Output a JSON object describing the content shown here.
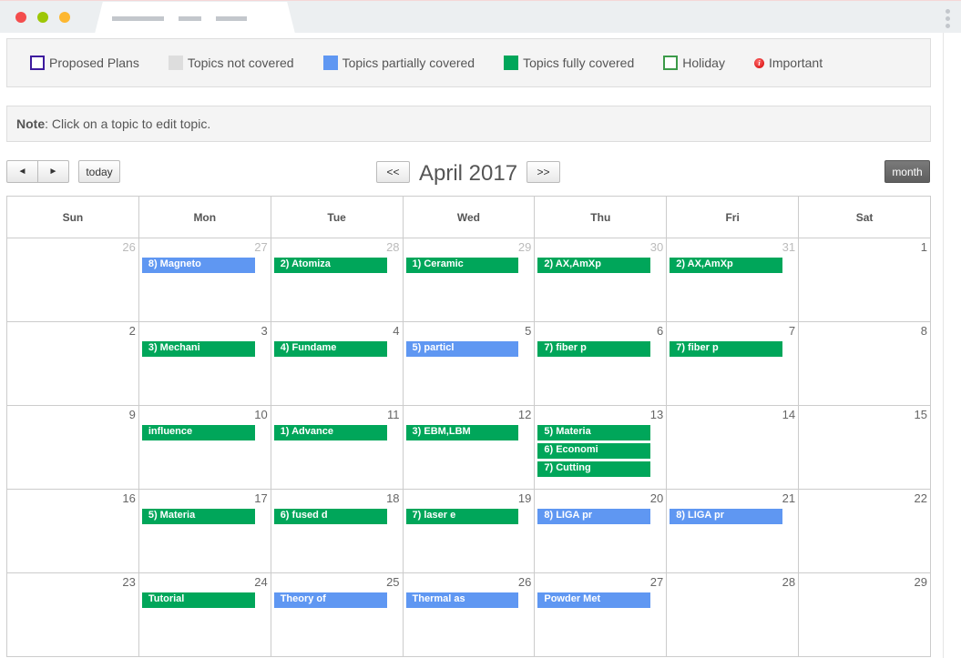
{
  "browser": {
    "window_controls": [
      "close",
      "minimize",
      "maximize"
    ],
    "colors": {
      "close": "#f44d4d",
      "minimize": "#9dc707",
      "maximize": "#fdb730"
    }
  },
  "legend": [
    {
      "label": "Proposed Plans",
      "type": "proposed"
    },
    {
      "label": "Topics not covered",
      "type": "notcov"
    },
    {
      "label": "Topics partially covered",
      "type": "partial"
    },
    {
      "label": "Topics fully covered",
      "type": "full"
    },
    {
      "label": "Holiday",
      "type": "holiday"
    },
    {
      "label": "Important",
      "type": "important"
    }
  ],
  "legend_colors": {
    "proposed": "#3d1a9e",
    "notcov": "#dddddd",
    "partial": "#5f97f2",
    "full": "#00a65a",
    "holiday": "#3c9a49",
    "important": "#d10000"
  },
  "note": {
    "bold": "Note",
    "text": ": Click on a topic to edit topic."
  },
  "toolbar": {
    "prev_icon": "◄",
    "next_icon": "►",
    "today_label": "today",
    "prev_year_label": "<<",
    "next_year_label": ">>",
    "title": "April 2017",
    "month_label": "month"
  },
  "calendar": {
    "weekdays": [
      "Sun",
      "Mon",
      "Tue",
      "Wed",
      "Thu",
      "Fri",
      "Sat"
    ],
    "weeks": [
      [
        {
          "day": "26",
          "other": true,
          "events": []
        },
        {
          "day": "27",
          "other": true,
          "events": [
            {
              "title": "8) Magneto",
              "status": "partial"
            }
          ]
        },
        {
          "day": "28",
          "other": true,
          "events": [
            {
              "title": "2) Atomiza",
              "status": "full"
            }
          ]
        },
        {
          "day": "29",
          "other": true,
          "events": [
            {
              "title": "1) Ceramic",
              "status": "full"
            }
          ]
        },
        {
          "day": "30",
          "other": true,
          "events": [
            {
              "title": "2) AX,AmXp",
              "status": "full"
            }
          ]
        },
        {
          "day": "31",
          "other": true,
          "events": [
            {
              "title": "2) AX,AmXp",
              "status": "full"
            }
          ]
        },
        {
          "day": "1",
          "other": false,
          "events": []
        }
      ],
      [
        {
          "day": "2",
          "other": false,
          "events": []
        },
        {
          "day": "3",
          "other": false,
          "events": [
            {
              "title": "3) Mechani",
              "status": "full"
            }
          ]
        },
        {
          "day": "4",
          "other": false,
          "events": [
            {
              "title": "4) Fundame",
              "status": "full"
            }
          ]
        },
        {
          "day": "5",
          "other": false,
          "events": [
            {
              "title": "5) particl",
              "status": "partial"
            }
          ]
        },
        {
          "day": "6",
          "other": false,
          "events": [
            {
              "title": "7) fiber p",
              "status": "full"
            }
          ]
        },
        {
          "day": "7",
          "other": false,
          "events": [
            {
              "title": "7) fiber p",
              "status": "full"
            }
          ]
        },
        {
          "day": "8",
          "other": false,
          "events": []
        }
      ],
      [
        {
          "day": "9",
          "other": false,
          "events": []
        },
        {
          "day": "10",
          "other": false,
          "events": [
            {
              "title": "influence",
              "status": "full"
            }
          ]
        },
        {
          "day": "11",
          "other": false,
          "events": [
            {
              "title": "1) Advance",
              "status": "full"
            }
          ]
        },
        {
          "day": "12",
          "other": false,
          "events": [
            {
              "title": "3) EBM,LBM",
              "status": "full"
            }
          ]
        },
        {
          "day": "13",
          "other": false,
          "events": [
            {
              "title": "5) Materia",
              "status": "full"
            },
            {
              "title": "6) Economi",
              "status": "full"
            },
            {
              "title": "7) Cutting",
              "status": "full"
            }
          ]
        },
        {
          "day": "14",
          "other": false,
          "events": []
        },
        {
          "day": "15",
          "other": false,
          "events": []
        }
      ],
      [
        {
          "day": "16",
          "other": false,
          "events": []
        },
        {
          "day": "17",
          "other": false,
          "events": [
            {
              "title": "5) Materia",
              "status": "full"
            }
          ]
        },
        {
          "day": "18",
          "other": false,
          "events": [
            {
              "title": "6) fused d",
              "status": "full"
            }
          ]
        },
        {
          "day": "19",
          "other": false,
          "events": [
            {
              "title": "7) laser e",
              "status": "full"
            }
          ]
        },
        {
          "day": "20",
          "other": false,
          "events": [
            {
              "title": "8) LIGA pr",
              "status": "partial"
            }
          ]
        },
        {
          "day": "21",
          "other": false,
          "events": [
            {
              "title": "8) LIGA pr",
              "status": "partial"
            }
          ]
        },
        {
          "day": "22",
          "other": false,
          "events": []
        }
      ],
      [
        {
          "day": "23",
          "other": false,
          "events": []
        },
        {
          "day": "24",
          "other": false,
          "events": [
            {
              "title": "Tutorial",
              "status": "full"
            }
          ]
        },
        {
          "day": "25",
          "other": false,
          "events": [
            {
              "title": "Theory of",
              "status": "partial"
            }
          ]
        },
        {
          "day": "26",
          "other": false,
          "events": [
            {
              "title": "Thermal as",
              "status": "partial"
            }
          ]
        },
        {
          "day": "27",
          "other": false,
          "events": [
            {
              "title": "Powder Met",
              "status": "partial"
            }
          ]
        },
        {
          "day": "28",
          "other": false,
          "events": []
        },
        {
          "day": "29",
          "other": false,
          "events": []
        }
      ]
    ]
  }
}
